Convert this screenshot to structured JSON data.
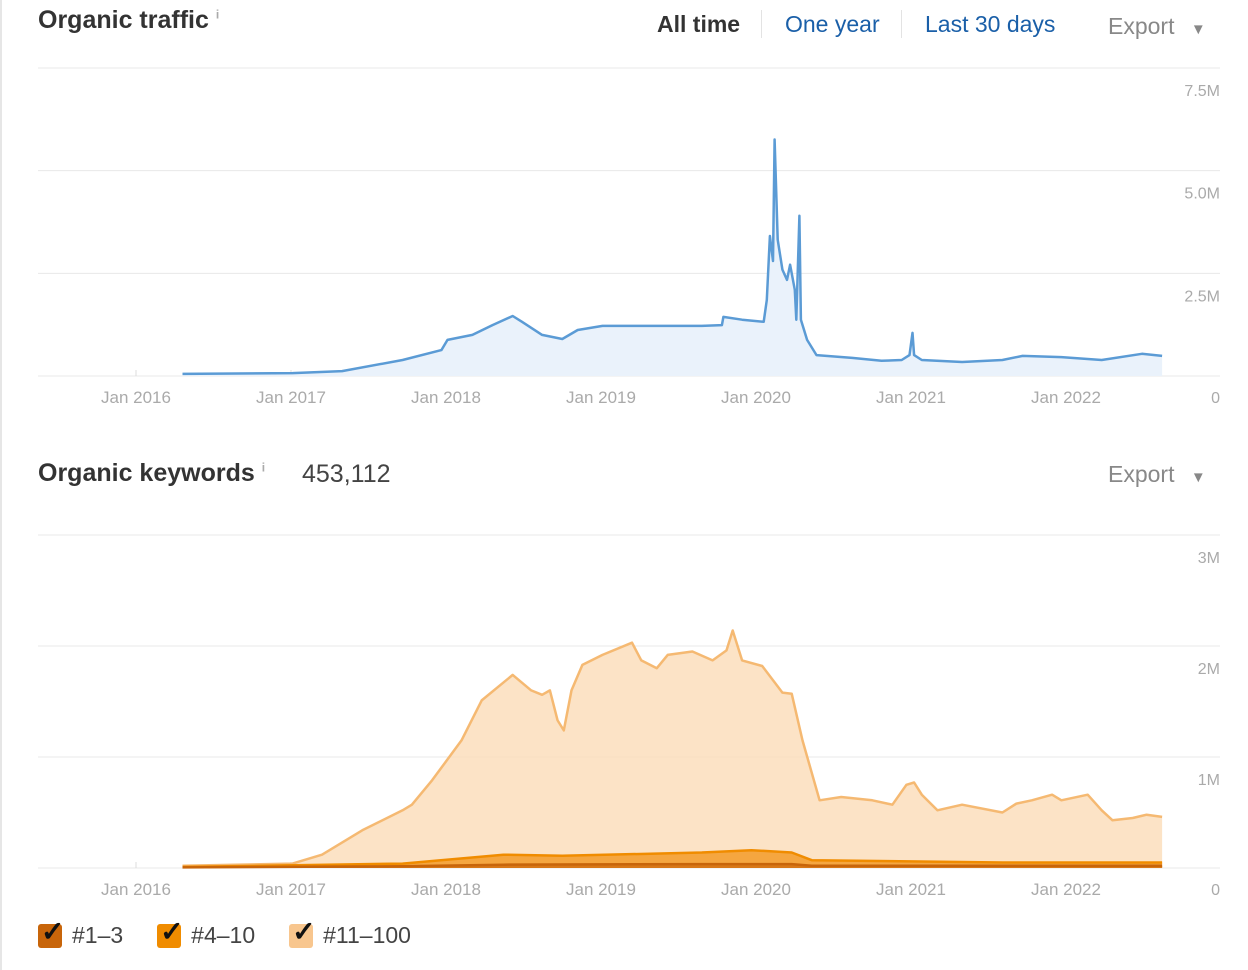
{
  "traffic": {
    "title": "Organic traffic",
    "info": "i",
    "filters": [
      "All time",
      "One year",
      "Last 30 days"
    ],
    "active_filter": "All time",
    "export_label": "Export",
    "export_caret": "▼"
  },
  "keywords": {
    "title": "Organic keywords",
    "info": "i",
    "count": "453,112",
    "export_label": "Export",
    "export_caret": "▼",
    "legend": [
      {
        "label": "#1–3",
        "color": "#c8650a",
        "checked": true
      },
      {
        "label": "#4–10",
        "color": "#f08c00",
        "checked": true
      },
      {
        "label": "#11–100",
        "color": "#f8c68e",
        "checked": true
      }
    ]
  },
  "chart_data": [
    {
      "type": "area",
      "title": "Organic traffic",
      "x_ticks": [
        "Jan 2016",
        "Jan 2017",
        "Jan 2018",
        "Jan 2019",
        "Jan 2020",
        "Jan 2021",
        "Jan 2022"
      ],
      "y_ticks": [
        "0",
        "2.5M",
        "5.0M",
        "7.5M"
      ],
      "y_tick_values": [
        0,
        2.5,
        5,
        7.5
      ],
      "ylim": [
        0,
        7.5
      ],
      "y_unit": "M",
      "grid": true,
      "series": [
        {
          "name": "Organic traffic",
          "color": "#5b9bd5",
          "fill": "#eaf2fb",
          "points": [
            [
              2016.3,
              0.05
            ],
            [
              2017.01,
              0.07
            ],
            [
              2017.33,
              0.12
            ],
            [
              2017.72,
              0.39
            ],
            [
              2017.97,
              0.63
            ],
            [
              2018.01,
              0.88
            ],
            [
              2018.17,
              1.0
            ],
            [
              2018.3,
              1.24
            ],
            [
              2018.43,
              1.46
            ],
            [
              2018.49,
              1.32
            ],
            [
              2018.62,
              1.0
            ],
            [
              2018.75,
              0.9
            ],
            [
              2018.85,
              1.12
            ],
            [
              2019.01,
              1.22
            ],
            [
              2019.65,
              1.22
            ],
            [
              2019.78,
              1.24
            ],
            [
              2019.79,
              1.44
            ],
            [
              2019.91,
              1.37
            ],
            [
              2020.05,
              1.32
            ],
            [
              2020.07,
              1.85
            ],
            [
              2020.09,
              3.41
            ],
            [
              2020.11,
              2.8
            ],
            [
              2020.12,
              5.76
            ],
            [
              2020.14,
              3.32
            ],
            [
              2020.17,
              2.59
            ],
            [
              2020.2,
              2.34
            ],
            [
              2020.22,
              2.71
            ],
            [
              2020.25,
              2.1
            ],
            [
              2020.26,
              1.37
            ],
            [
              2020.28,
              3.9
            ],
            [
              2020.29,
              1.37
            ],
            [
              2020.33,
              0.88
            ],
            [
              2020.39,
              0.51
            ],
            [
              2020.62,
              0.44
            ],
            [
              2020.81,
              0.37
            ],
            [
              2020.94,
              0.39
            ],
            [
              2020.99,
              0.51
            ],
            [
              2021.01,
              1.05
            ],
            [
              2021.02,
              0.51
            ],
            [
              2021.07,
              0.39
            ],
            [
              2021.33,
              0.34
            ],
            [
              2021.59,
              0.39
            ],
            [
              2021.72,
              0.49
            ],
            [
              2021.97,
              0.46
            ],
            [
              2022.23,
              0.39
            ],
            [
              2022.49,
              0.54
            ],
            [
              2022.62,
              0.49
            ]
          ]
        }
      ]
    },
    {
      "type": "area",
      "title": "Organic keywords",
      "stacked": true,
      "x_ticks": [
        "Jan 2016",
        "Jan 2017",
        "Jan 2018",
        "Jan 2019",
        "Jan 2020",
        "Jan 2021",
        "Jan 2022"
      ],
      "y_ticks": [
        "0",
        "1M",
        "2M",
        "3M"
      ],
      "y_tick_values": [
        0,
        1,
        2,
        3
      ],
      "ylim": [
        0,
        3
      ],
      "y_unit": "M",
      "grid": true,
      "legend_position": "bottom-left",
      "series": [
        {
          "name": "#11–100 (cumulative top)",
          "color": "#f5b972",
          "fill": "#fbdcb8",
          "points": [
            [
              2016.3,
              0.02
            ],
            [
              2017.01,
              0.04
            ],
            [
              2017.2,
              0.12
            ],
            [
              2017.46,
              0.34
            ],
            [
              2017.72,
              0.52
            ],
            [
              2017.78,
              0.57
            ],
            [
              2017.91,
              0.79
            ],
            [
              2018.1,
              1.15
            ],
            [
              2018.23,
              1.51
            ],
            [
              2018.43,
              1.74
            ],
            [
              2018.55,
              1.6
            ],
            [
              2018.62,
              1.56
            ],
            [
              2018.67,
              1.6
            ],
            [
              2018.72,
              1.33
            ],
            [
              2018.76,
              1.24
            ],
            [
              2018.81,
              1.6
            ],
            [
              2018.88,
              1.83
            ],
            [
              2019.01,
              1.92
            ],
            [
              2019.2,
              2.03
            ],
            [
              2019.26,
              1.87
            ],
            [
              2019.36,
              1.8
            ],
            [
              2019.43,
              1.92
            ],
            [
              2019.59,
              1.95
            ],
            [
              2019.72,
              1.87
            ],
            [
              2019.81,
              1.96
            ],
            [
              2019.85,
              2.14
            ],
            [
              2019.91,
              1.87
            ],
            [
              2020.04,
              1.82
            ],
            [
              2020.17,
              1.58
            ],
            [
              2020.23,
              1.57
            ],
            [
              2020.3,
              1.15
            ],
            [
              2020.41,
              0.61
            ],
            [
              2020.55,
              0.64
            ],
            [
              2020.75,
              0.61
            ],
            [
              2020.88,
              0.57
            ],
            [
              2020.97,
              0.75
            ],
            [
              2021.02,
              0.77
            ],
            [
              2021.07,
              0.66
            ],
            [
              2021.17,
              0.52
            ],
            [
              2021.33,
              0.57
            ],
            [
              2021.59,
              0.5
            ],
            [
              2021.68,
              0.58
            ],
            [
              2021.78,
              0.61
            ],
            [
              2021.91,
              0.66
            ],
            [
              2021.97,
              0.61
            ],
            [
              2022.14,
              0.66
            ],
            [
              2022.23,
              0.52
            ],
            [
              2022.3,
              0.43
            ],
            [
              2022.43,
              0.45
            ],
            [
              2022.52,
              0.48
            ],
            [
              2022.62,
              0.46
            ]
          ]
        },
        {
          "name": "#4–10 (cumulative top)",
          "color": "#f08c00",
          "fill": "#f5a640",
          "points": [
            [
              2016.3,
              0.01
            ],
            [
              2017.72,
              0.04
            ],
            [
              2018.37,
              0.12
            ],
            [
              2018.75,
              0.11
            ],
            [
              2019.65,
              0.14
            ],
            [
              2019.97,
              0.16
            ],
            [
              2020.23,
              0.14
            ],
            [
              2020.36,
              0.07
            ],
            [
              2021.59,
              0.05
            ],
            [
              2022.62,
              0.05
            ]
          ]
        },
        {
          "name": "#1–3",
          "color": "#c8650a",
          "fill": "#d87818",
          "points": [
            [
              2016.3,
              0.005
            ],
            [
              2017.72,
              0.015
            ],
            [
              2018.37,
              0.03
            ],
            [
              2019.65,
              0.035
            ],
            [
              2020.23,
              0.035
            ],
            [
              2020.36,
              0.02
            ],
            [
              2022.62,
              0.02
            ]
          ]
        }
      ]
    }
  ]
}
